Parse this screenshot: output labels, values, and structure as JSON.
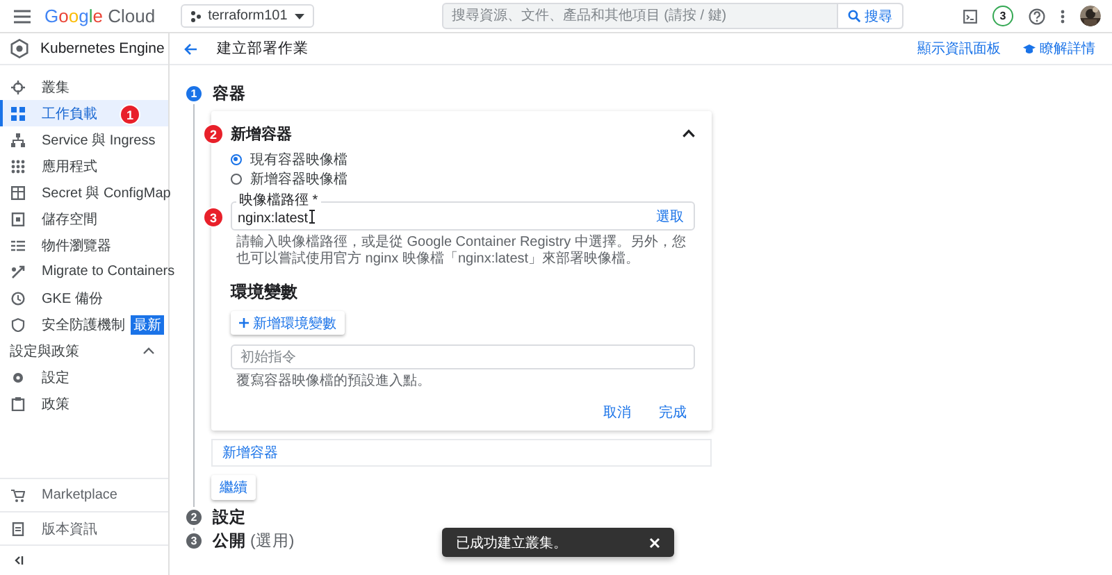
{
  "top_bar": {
    "logo": "Google Cloud",
    "project": "terraform101",
    "search": {
      "placeholder": "搜尋資源、文件、產品和其他項目 (請按 / 鍵)"
    },
    "search_button": "搜尋",
    "notification_count": "3"
  },
  "product": {
    "title": "Kubernetes Engine"
  },
  "sidebar": {
    "items": [
      {
        "label": "叢集",
        "selected": false
      },
      {
        "label": "工作負載",
        "selected": true,
        "annotation": "1"
      },
      {
        "label": "Service 與 Ingress",
        "selected": false
      },
      {
        "label": "應用程式",
        "selected": false
      },
      {
        "label": "Secret 與 ConfigMap",
        "selected": false
      },
      {
        "label": "儲存空間",
        "selected": false
      },
      {
        "label": "物件瀏覽器",
        "selected": false
      },
      {
        "label": "Migrate to Containers",
        "selected": false
      },
      {
        "label": "GKE 備份",
        "selected": false
      },
      {
        "label": "安全防護機制",
        "selected": false,
        "badge": "最新"
      }
    ],
    "section": {
      "title": "設定與政策",
      "expanded": true,
      "items": [
        {
          "label": "設定",
          "selected": false
        },
        {
          "label": "政策",
          "selected": false
        }
      ]
    },
    "footer": [
      {
        "label": "Marketplace",
        "selected": false
      },
      {
        "label": "版本資訊",
        "selected": false
      }
    ]
  },
  "page": {
    "title": "建立部署作業",
    "actions": [
      "顯示資訊面板",
      "瞭解詳情"
    ]
  },
  "steps": [
    {
      "number": "1",
      "title": "容器",
      "active": true
    },
    {
      "number": "2",
      "title": "設定",
      "active": false
    },
    {
      "number": "3",
      "title": "公開",
      "suffix": "(選用)",
      "active": false
    }
  ],
  "container_card": {
    "title": "新增容器",
    "expanded": true,
    "annotation": "2",
    "source_options": [
      {
        "label": "現有容器映像檔",
        "selected": true
      },
      {
        "label": "新增容器映像檔",
        "selected": false
      }
    ],
    "image_field": {
      "label": "映像檔路徑 *",
      "value": "nginx:latest",
      "action": "選取",
      "annotation": "3"
    },
    "image_help": "請輸入映像檔路徑，或是從 Google Container Registry 中選擇。另外，您也可以嘗試使用官方 nginx 映像檔「nginx:latest」來部署映像檔。",
    "env_title": "環境變數",
    "add_env_button": "新增環境變數",
    "command_field": {
      "placeholder": "初始指令"
    },
    "command_help": "覆寫容器映像檔的預設進入點。",
    "buttons": [
      "取消",
      "完成"
    ]
  },
  "add_container": "新增容器",
  "continue_button": "繼續",
  "toast": {
    "message": "已成功建立叢集。"
  }
}
